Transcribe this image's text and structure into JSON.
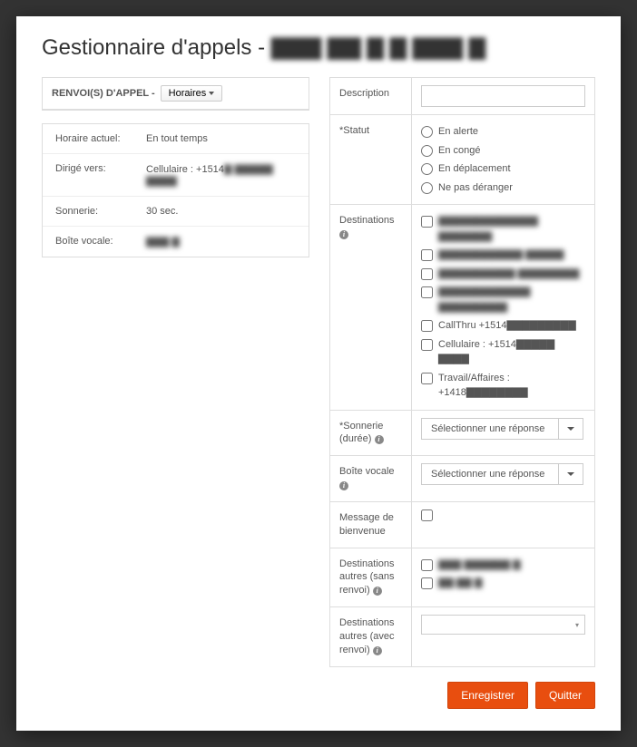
{
  "page": {
    "title_prefix": "Gestionnaire d'appels - ",
    "title_masked": "▇▇▇ ▇▇ ▇ ▇ ▇▇▇ ▇"
  },
  "left_panel": {
    "header_text": "RENVOI(S) D'APPEL -",
    "dropdown_label": "Horaires",
    "rows": {
      "horaire_label": "Horaire actuel:",
      "horaire_value": "En tout temps",
      "dirige_label": "Dirigé vers:",
      "dirige_value_prefix": "Cellulaire : +1514",
      "dirige_value_masked": "▇ ▇▇▇▇▇  ▇▇▇▇",
      "sonnerie_label": "Sonnerie:",
      "sonnerie_value": "30 sec.",
      "boite_label": "Boîte vocale:",
      "boite_value_masked": "▇▇▇ ▇"
    }
  },
  "form": {
    "description_label": "Description",
    "statut_label": "*Statut",
    "statut_options": [
      "En alerte",
      "En congé",
      "En déplacement",
      "Ne pas déranger"
    ],
    "destinations_label": "Destinations",
    "destinations": [
      "▇▇▇▇▇▇▇▇▇▇▇▇▇ ▇▇▇▇▇▇▇",
      "▇▇▇▇▇▇▇▇▇▇▇ ▇▇▇▇▇",
      "▇▇▇▇▇▇▇▇▇▇ ▇▇▇▇▇▇▇▇",
      "▇▇▇▇▇▇▇▇▇▇▇▇ ▇▇▇▇▇▇▇▇▇",
      "CallThru +1514▇▇▇▇▇▇▇▇▇",
      "Cellulaire : +1514▇▇▇▇▇ ▇▇▇▇",
      "Travail/Affaires : +1418▇▇▇▇▇▇▇▇"
    ],
    "sonnerie_label": "*Sonnerie (durée)",
    "sonnerie_placeholder": "Sélectionner une réponse",
    "boite_label": "Boîte vocale",
    "boite_placeholder": "Sélectionner une réponse",
    "message_label": "Message de bienvenue",
    "dest_sans_label": "Destinations autres (sans renvoi)",
    "dest_sans_options": [
      "▇▇▇ ▇▇▇▇▇▇ ▇",
      "▇▇ ▇▇ ▇"
    ],
    "dest_avec_label": "Destinations autres (avec renvoi)"
  },
  "footer": {
    "save": "Enregistrer",
    "quit": "Quitter"
  }
}
